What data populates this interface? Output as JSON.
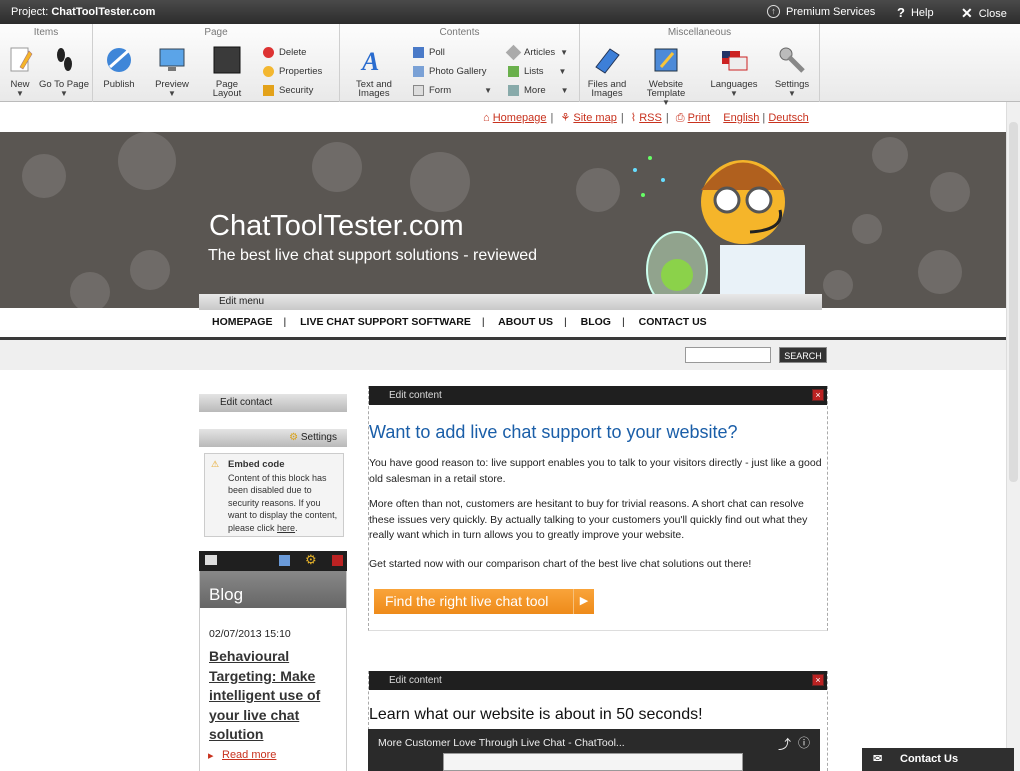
{
  "topbar": {
    "project_label": "Project:",
    "project_name": "ChatToolTester.com",
    "premium": "Premium Services",
    "help": "Help",
    "close": "Close"
  },
  "ribbon": {
    "groups": {
      "items": "Items",
      "page": "Page",
      "contents": "Contents",
      "misc": "Miscellaneous"
    },
    "new": "New",
    "goto": "Go To Page",
    "publish": "Publish",
    "preview": "Preview",
    "page_layout": "Page Layout",
    "delete": "Delete",
    "properties": "Properties",
    "security": "Security",
    "text_images": "Text and Images",
    "poll": "Poll",
    "photo_gallery": "Photo Gallery",
    "form": "Form",
    "articles": "Articles",
    "lists": "Lists",
    "more": "More",
    "files_images": "Files and Images",
    "website_template": "Website Template",
    "languages": "Languages",
    "settings": "Settings"
  },
  "toplinks": {
    "homepage": "Homepage",
    "sitemap": "Site map",
    "rss": "RSS",
    "print": "Print",
    "english": "English",
    "deutsch": "Deutsch"
  },
  "hero": {
    "title": "ChatToolTester.com",
    "subtitle": "The best live chat support solutions - reviewed"
  },
  "edit_menu": "Edit menu",
  "nav": [
    "HOMEPAGE",
    "LIVE CHAT SUPPORT SOFTWARE",
    "ABOUT US",
    "BLOG",
    "CONTACT US"
  ],
  "search": {
    "button": "SEARCH"
  },
  "sidebar": {
    "edit_contact": "Edit contact",
    "settings": "Settings",
    "embed_title": "Embed code",
    "embed_text": "Content of this block has been disabled due to security reasons. If you want to display the content, please click",
    "embed_link": "here",
    "blog_heading": "Blog",
    "blog_date": "02/07/2013 15:10",
    "blog_title": "Behavioural Targeting: Make intelligent use of your live chat solution",
    "read_more": "Read more"
  },
  "content1": {
    "edit": "Edit content",
    "heading": "Want to add live chat support to your website?",
    "p1": "You have good reason to: live support enables you to talk to your visitors directly - just like a good old salesman in a retail store.",
    "p2": "More often than not, customers are hesitant to buy for trivial reasons. A short chat can resolve these issues very quickly. By actually talking to your customers you'll quickly find out what they really want which in turn allows you to greatly improve your website.",
    "p3": "Get started now with our comparison chart of the best live chat solutions out there!",
    "cta": "Find the right live chat tool"
  },
  "content2": {
    "edit": "Edit content",
    "heading": "Learn what our website is about in 50 seconds!",
    "video_title": "More Customer Love Through Live Chat - ChatTool..."
  },
  "contact_us": "Contact Us",
  "colors": {
    "accent": "#1a5ea8",
    "link": "#c8321e",
    "cta": "#f39a2b",
    "toolbar": "#333333"
  }
}
